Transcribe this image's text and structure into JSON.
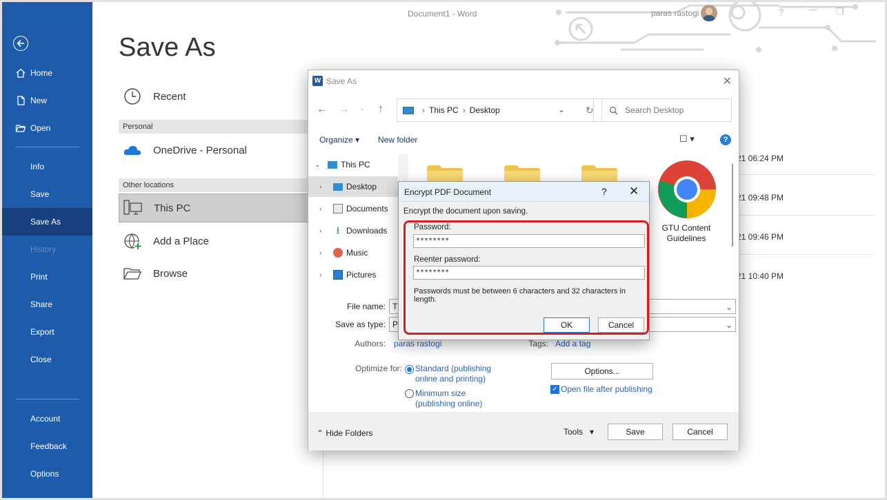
{
  "window": {
    "title": "Document1 - Word",
    "user": "paras rastogi",
    "controls": [
      "?",
      "—",
      "❐"
    ]
  },
  "sidebar": {
    "items": [
      {
        "label": "Home",
        "icon": "home-icon"
      },
      {
        "label": "New",
        "icon": "new-document-icon"
      },
      {
        "label": "Open",
        "icon": "open-folder-icon"
      },
      {
        "label": "Info"
      },
      {
        "label": "Save"
      },
      {
        "label": "Save As"
      },
      {
        "label": "History"
      },
      {
        "label": "Print"
      },
      {
        "label": "Share"
      },
      {
        "label": "Export"
      },
      {
        "label": "Close"
      },
      {
        "label": "Account"
      },
      {
        "label": "Feedback"
      },
      {
        "label": "Options"
      }
    ]
  },
  "backstage": {
    "title": "Save As",
    "recent": "Recent",
    "personal_header": "Personal",
    "onedrive": "OneDrive - Personal",
    "other_header": "Other locations",
    "this_pc": "This PC",
    "add_place": "Add a Place",
    "browse": "Browse",
    "times": [
      "21 06:24 PM",
      "21 09:48 PM",
      "21 09:46 PM",
      "21 10:40 PM"
    ]
  },
  "save_dialog": {
    "title": "Save As",
    "word_icon": "W",
    "path": [
      "This PC",
      "Desktop"
    ],
    "search_placeholder": "Search Desktop",
    "organize": "Organize",
    "new_folder": "New folder",
    "tree": [
      "This PC",
      "Desktop",
      "Documents",
      "Downloads",
      "Music",
      "Pictures"
    ],
    "chrome_item": "GTU Content Guidelines",
    "file_name_label": "File name:",
    "file_name_value": "T",
    "save_type_label": "Save as type:",
    "save_type_value": "P",
    "authors_label": "Authors:",
    "authors_value": "paras rastogi",
    "tags_label": "Tags:",
    "tags_value": "Add a tag",
    "optimize_label": "Optimize for:",
    "standard_line1": "Standard (publishing",
    "standard_line2": "online and printing)",
    "minimum_line1": "Minimum size",
    "minimum_line2": "(publishing online)",
    "options_button": "Options...",
    "open_after": "Open file after publishing",
    "hide_folders": "Hide Folders",
    "tools": "Tools",
    "save_button": "Save",
    "cancel_button": "Cancel"
  },
  "encrypt": {
    "title": "Encrypt PDF Document",
    "help": "?",
    "close": "✕",
    "intro": "Encrypt the document upon saving.",
    "password_label": "Password:",
    "password_value": "********",
    "reenter_label": "Reenter password:",
    "reenter_value": "********",
    "note": "Passwords must be between 6 characters and 32 characters in length.",
    "ok": "OK",
    "cancel": "Cancel"
  },
  "colors": {
    "sidebar": "#1f5bab",
    "sidebar_active": "#17407c",
    "highlight": "#d41f24",
    "accent": "#1a73e8"
  }
}
